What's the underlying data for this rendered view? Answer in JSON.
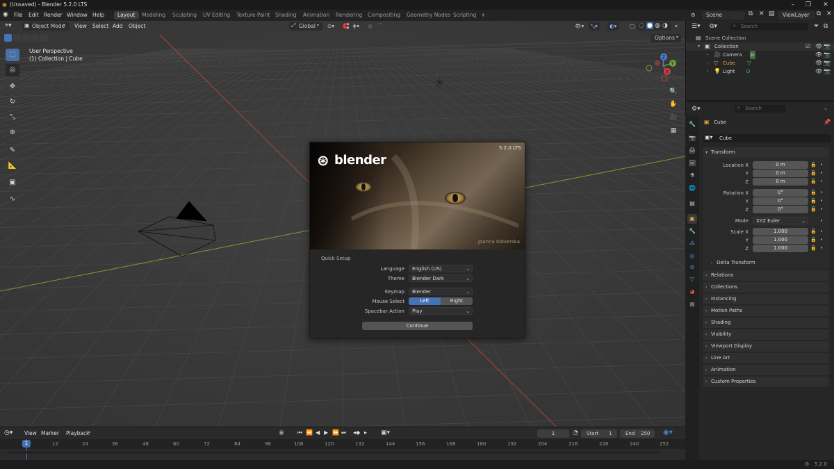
{
  "window": {
    "title": "(Unsaved) - Blender 5.2.0 LTS"
  },
  "menu": {
    "items": [
      "File",
      "Edit",
      "Render",
      "Window",
      "Help"
    ]
  },
  "workspaces": [
    "Layout",
    "Modeling",
    "Sculpting",
    "UV Editing",
    "Texture Paint",
    "Shading",
    "Animation",
    "Rendering",
    "Compositing",
    "Geometry Nodes",
    "Scripting"
  ],
  "workspace_add": "+",
  "scene": {
    "label": "Scene",
    "viewlayer": "ViewLayer"
  },
  "viewport": {
    "mode": "Object Mode",
    "menu": [
      "View",
      "Select",
      "Add",
      "Object"
    ],
    "orientation": "Global",
    "options": "Options",
    "overlay_title": "User Perspective",
    "overlay_sub": "(1) Collection | Cube",
    "gizmo": {
      "x": "X",
      "y": "Y",
      "z": "Z"
    }
  },
  "splash": {
    "logo": "blender",
    "version": "5.2.0 LTS",
    "credit": "Joanna Kobierska",
    "quick_setup": "Quick Setup",
    "language_label": "Language",
    "language_value": "English (US)",
    "theme_label": "Theme",
    "theme_value": "Blender Dark",
    "keymap_label": "Keymap",
    "keymap_value": "Blender",
    "mouse_label": "Mouse Select",
    "mouse_left": "Left",
    "mouse_right": "Right",
    "spacebar_label": "Spacebar Action",
    "spacebar_value": "Play",
    "continue": "Continue"
  },
  "timeline": {
    "menu": [
      "View",
      "Marker",
      "Playback"
    ],
    "current_frame": "1",
    "start_label": "Start",
    "start_value": "1",
    "end_label": "End",
    "end_value": "250",
    "playhead": "1",
    "ticks": [
      "12",
      "24",
      "36",
      "48",
      "60",
      "72",
      "84",
      "96",
      "108",
      "120",
      "132",
      "144",
      "156",
      "168",
      "180",
      "192",
      "204",
      "216",
      "228",
      "240",
      "252"
    ]
  },
  "outliner": {
    "search_placeholder": "Search",
    "scene_collection": "Scene Collection",
    "collection": "Collection",
    "items": [
      "Camera",
      "Cube",
      "Light"
    ]
  },
  "properties": {
    "search_placeholder": "Search",
    "object_name": "Cube",
    "object_field": "Cube",
    "transform": "Transform",
    "location_label": "Location X",
    "y": "Y",
    "z": "Z",
    "location": [
      "0 m",
      "0 m",
      "0 m"
    ],
    "rotation_label": "Rotation X",
    "rotation": [
      "0°",
      "0°",
      "0°"
    ],
    "mode_label": "Mode",
    "mode_value": "XYZ Euler",
    "scale_label": "Scale X",
    "scale": [
      "1.000",
      "1.000",
      "1.000"
    ],
    "delta": "Delta Transform",
    "panels": [
      "Relations",
      "Collections",
      "Instancing",
      "Motion Paths",
      "Shading",
      "Visibility",
      "Viewport Display",
      "Line Art",
      "Animation",
      "Custom Properties"
    ]
  },
  "status": {
    "version": "5.2.0"
  },
  "colors": {
    "accent": "#4772b3",
    "origin": "#e3a94a",
    "axis_x": "#c94343",
    "axis_y": "#6aa33a",
    "axis_z": "#4a7fd1"
  }
}
